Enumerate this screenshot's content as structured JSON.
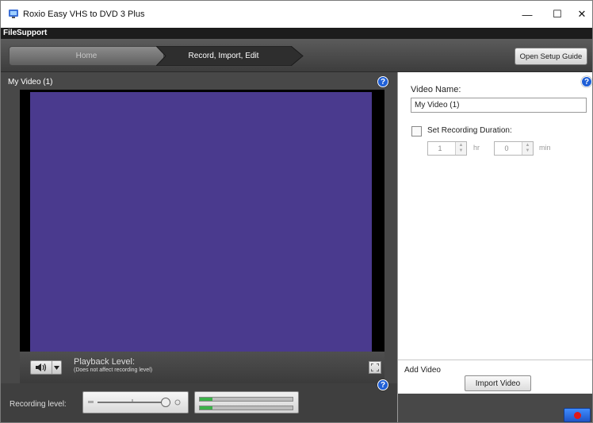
{
  "window": {
    "title": "Roxio Easy VHS to DVD 3 Plus",
    "controls": {
      "minimize": "—",
      "maximize": "☐",
      "close": "✕"
    }
  },
  "menu": {
    "items": [
      "File",
      "Support"
    ]
  },
  "nav": {
    "home": "Home",
    "record": "Record, Import, Edit",
    "setup_guide": "Open Setup Guide"
  },
  "video": {
    "title": "My Video (1)",
    "preview_color": "#4a3a8e",
    "playback_label": "Playback Level:",
    "playback_note": "(Does not affect recording level)",
    "recording_label": "Recording level:",
    "meter_levels": [
      0.14,
      0.14
    ]
  },
  "settings": {
    "name_label": "Video Name:",
    "name_value": "My Video (1)",
    "duration_label": "Set Recording Duration:",
    "hours": {
      "value": "1",
      "unit": "hr"
    },
    "minutes": {
      "value": "0",
      "unit": "min"
    }
  },
  "add_video": {
    "label": "Add Video",
    "import_button": "Import Video"
  },
  "help_icon": "?",
  "icons": {
    "app": "roxio-app-icon",
    "volume": "speaker-icon",
    "dropdown": "chevron-down-icon",
    "fullscreen": "fullscreen-icon",
    "record": "record-icon",
    "help": "help-icon"
  }
}
